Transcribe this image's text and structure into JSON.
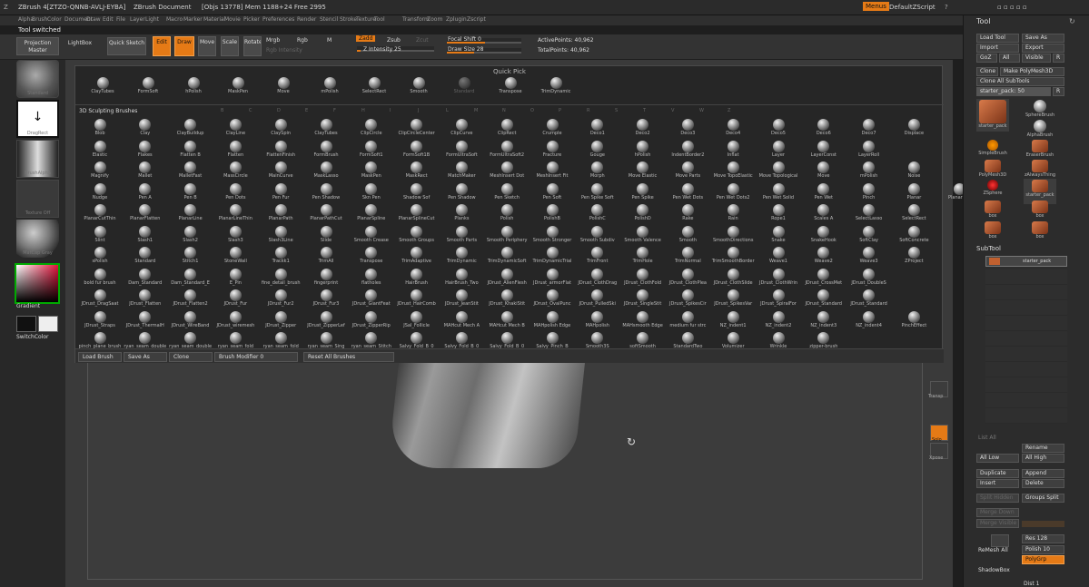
{
  "title_bar": {
    "app": "ZBrush 4[ZTZO-QNNB-AVLJ-EYBA]",
    "doc": "ZBrush Document",
    "stats": "[Objs 13778] Mem 1188+24 Free 2995",
    "menus_label": "Menus",
    "script_label": "DefaultZScript"
  },
  "menu_bar": [
    "Alpha",
    "Brush",
    "Color",
    "Document",
    "Draw",
    "Edit",
    "File",
    "Layer",
    "Light",
    "Macro",
    "Marker",
    "Material",
    "Movie",
    "Picker",
    "Preferences",
    "Render",
    "Stencil",
    "Stroke",
    "Texture",
    "Tool",
    "Transform",
    "Zoom",
    "Zplugin",
    "Zscript"
  ],
  "status": "Tool switched",
  "toolbar": {
    "projection_master": "Projection Master",
    "lightbox": "LightBox",
    "quick_sketch": "Quick Sketch",
    "edit": "Edit",
    "draw": "Draw",
    "move": "Move",
    "scale": "Scale",
    "rotate": "Rotate",
    "mrgb": "Mrgb",
    "rgb": "Rgb",
    "m": "M",
    "rgb_intensity": "Rgb Intensity",
    "zadd": "Zadd",
    "zsub": "Zsub",
    "zcut": "Zcut",
    "z_intensity": "Z Intensity 25",
    "focal_shift": "Focal Shift 0",
    "draw_size": "Draw Size 28",
    "active_points": "ActivePoints: 40,962",
    "total_points": "TotalPoints: 40,962"
  },
  "left_shelf": [
    {
      "label": "Standard"
    },
    {
      "label": "DragRect"
    },
    {
      "label": "BrushAlpha"
    },
    {
      "label": "Texture Off"
    },
    {
      "label": "MatCap Gray"
    },
    {
      "label": "Gradient"
    },
    {
      "label": "SwitchColor"
    }
  ],
  "colors": {
    "accent": "#e57a16",
    "panel": "#262626",
    "background": "#1e1e1e"
  },
  "quick_pick": {
    "title": "Quick Pick",
    "items": [
      "ClayTubes",
      "FormSoft",
      "hPolish",
      "MaskPen",
      "Move",
      "mPolish",
      "SelectRect",
      "Smooth",
      "Standard",
      "Transpose",
      "TrimDynamic"
    ]
  },
  "brushes": {
    "header": "3D Sculpting Brushes",
    "letters": [
      "B",
      "C",
      "D",
      "E",
      "F",
      "H",
      "I",
      "J",
      "L",
      "M",
      "N",
      "O",
      "P",
      "R",
      "S",
      "T",
      "V",
      "W",
      "Z"
    ],
    "rows": [
      [
        "Blob",
        "Clay",
        "ClayBuildup",
        "ClayLine",
        "ClaySpin",
        "ClayTubes",
        "ClipCircle",
        "ClipCircleCenter",
        "ClipCurve",
        "ClipRect",
        "Crumple",
        "Deco1",
        "Deco2",
        "Deco3",
        "Deco4",
        "Deco5",
        "Deco6",
        "Deco7",
        "Displace"
      ],
      [
        "Elastic",
        "Flakes",
        "Flatten B",
        "Flatten",
        "FlattenFinish",
        "FormBrush",
        "FormSoft1",
        "FormSoft1B",
        "FormUltraSoft",
        "FormUltraSoft2",
        "Fracture",
        "Gouge",
        "hPolish",
        "IndentBorder2",
        "Inflat",
        "Layer",
        "LayerConst",
        "LayerRoll"
      ],
      [
        "Magnify",
        "Mallet",
        "MalletFast",
        "MassCircle",
        "MainCurve",
        "MaskLasso",
        "MaskPen",
        "MaskRect",
        "MatchMaker",
        "MeshInsert Dot",
        "MeshInsert Fit",
        "Morph",
        "Move Elastic",
        "Move Parts",
        "Move TopoElastic",
        "Move Topological",
        "Move",
        "mPolish",
        "Noise"
      ],
      [
        "Nudge",
        "Pen A",
        "Pen B",
        "Pen Dots",
        "Pen Fur",
        "Pen Shadow",
        "Skn Pen",
        "Shadow Sof",
        "Pen Shadow",
        "Pen Sketch",
        "Pen Soft",
        "Pen Spike Soft",
        "Pen Spike",
        "Pen Wet Dots",
        "Pen Wet Dots2",
        "Pen Wet Solid",
        "Pen Wet",
        "Pinch",
        "Planar",
        "PlanarCut"
      ],
      [
        "PlanarCutThin",
        "PlanarFlatten",
        "PlanarLine",
        "PlanarLineThin",
        "PlanarPath",
        "PlanarPathCut",
        "PlanarSpline",
        "PlanarSplineCut",
        "Planks",
        "Polish",
        "PolishB",
        "PolishC",
        "PolishD",
        "Rake",
        "Rain",
        "Rope1",
        "Scales A",
        "SelectLasso",
        "SelectRect"
      ],
      [
        "Slint",
        "Slash1",
        "Slash2",
        "Slash3",
        "Slash3Line",
        "Slide",
        "Smooth Crease",
        "Smooth Groups",
        "Smooth Parts",
        "Smooth Periphery",
        "Smooth Stronger",
        "Smooth Subdiv",
        "Smooth Valence",
        "Smooth",
        "SmoothDirections",
        "Snake",
        "SnakeHook",
        "SoftClay",
        "SoftConcrete"
      ],
      [
        "sPolish",
        "Standard",
        "Stitch1",
        "StoneWall",
        "Trackk1",
        "TrimAll",
        "Transpose",
        "TrimAdaptive",
        "TrimDynamic",
        "TrimDynamicSoft",
        "TrimDynamicTrial",
        "TrimFront",
        "TrimHole",
        "TrimNormal",
        "TrimSmoothBorder",
        "Weave1",
        "Weave2",
        "Weave3",
        "ZProject"
      ],
      [
        "bold fur brush",
        "Dam_Standard",
        "Dam_Standard_E",
        "E_Pin",
        "fine_detail_brush",
        "fingerprint",
        "flatholes",
        "HairBrush",
        "HairBrush_Two",
        "JDrust_AlienFlesh",
        "JDrust_armorFlat",
        "JDrust_ClothDrag",
        "JDrust_ClothFold",
        "JDrust_ClothPlea",
        "JDrust_ClothSlide",
        "JDrust_ClothWrin",
        "JDrust_CrossMet",
        "JDrust_DoubleS"
      ],
      [
        "JDrust_DragSaat",
        "JDrust_Flatten",
        "JDrust_Flatten2",
        "JDrust_Fur",
        "JDrust_Fur2",
        "JDrust_Fur3",
        "JDrust_GiantFeat",
        "JDrust_HairComb",
        "JDrust_JeanStit",
        "JDrust_KhakiStit",
        "JDrust_OvalPunc",
        "JDrust_PulledSki",
        "JDrust_SingleStit",
        "JDrust_SpikesCir",
        "JDrust_SpikesVar",
        "JDrust_SpiralFor",
        "JDrust_Standard",
        "JDrust_Standard"
      ],
      [
        "JDrust_Straps",
        "JDrust_ThermalH",
        "JDrust_WireBand",
        "JDrust_wiremesh",
        "JDrust_Zipper",
        "JDrust_ZipperLef",
        "JDrust_ZipperRip",
        "JSal_Follicle",
        "MAHcut Mech A",
        "MAHcut Mech B",
        "MAHpolish Edge",
        "MAHpolish",
        "MAHsmooth Edge",
        "medium fur strc",
        "NZ_indent1",
        "NZ_indent2",
        "NZ_indent3",
        "NZ_indent4",
        "PinchEffect"
      ],
      [
        "pinch_plane_brush",
        "ryan_seam_double",
        "ryan_seam_double",
        "ryan_seam_fold",
        "ryan_seam_fold",
        "ryan_seam_Sing",
        "ryan_seam_Stitch",
        "Salvy_Fold_B_0",
        "Salvy_Fold_B_0",
        "Salvy_Fold_B_0",
        "Salvy_Pinch_B",
        "Smooth3S",
        "softSmooth",
        "StandardTwo",
        "Volumizer",
        "Wrinkle",
        "zipper-brush"
      ]
    ]
  },
  "popup_footer": {
    "load": "Load Brush",
    "save": "Save As",
    "clone": "Clone",
    "modifier": "Brush Modifier 0",
    "reset": "Reset All Brushes"
  },
  "right_strip": [
    "Transp",
    "Solo",
    "Xpose"
  ],
  "tool_panel": {
    "title": "Tool",
    "load_tool": "Load Tool",
    "save_as": "Save As",
    "import": "Import",
    "export": "Export",
    "goz": "GoZ",
    "all": "All",
    "visible": "Visible",
    "r": "R",
    "clone": "Clone",
    "make_polymesh": "Make PolyMesh3D",
    "clone_all": "Clone All SubTools",
    "current": "starter_pack: 50",
    "thumbs": [
      "starter_pack",
      "SphereBrush",
      "AlphaBrush",
      "SimpleBrush",
      "EraserBrush",
      "PolyMesh3D",
      "zAlwaysThing",
      "ZSphere",
      "starter_pack",
      "box",
      "box",
      "box",
      "box"
    ],
    "subtool": "SubTool",
    "subtool_item": "starter_pack",
    "list_all": "List All",
    "rename": "Rename",
    "all_low": "All Low",
    "all_high": "All High",
    "duplicate": "Duplicate",
    "append": "Append",
    "insert": "Insert",
    "delete": "Delete",
    "split_hidden": "Split Hidden",
    "groups_split": "Groups Split",
    "merge_down": "Merge Down",
    "merge_visible": "Merge Visible",
    "res": "Res 128",
    "polish": "Polish 10",
    "remesh_all": "ReMesh All",
    "polygrp": "PolyGrp",
    "shadowbox": "ShadowBox",
    "dist": "Dist 1"
  }
}
